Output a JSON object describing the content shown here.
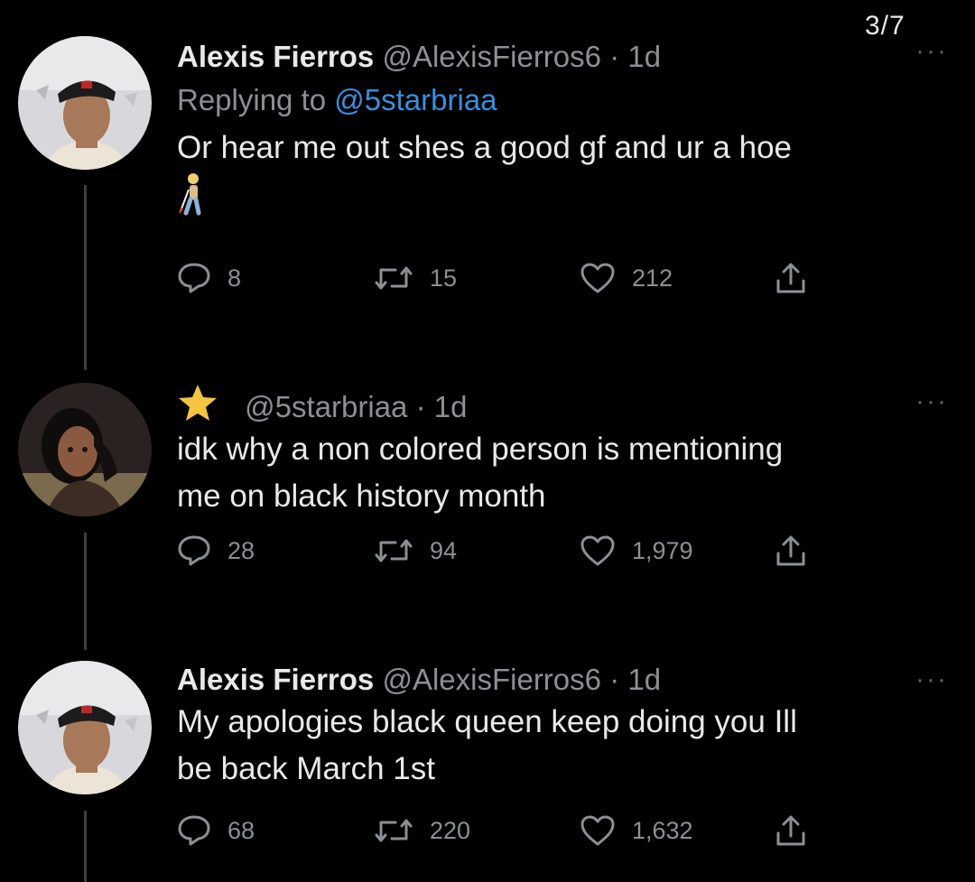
{
  "page_counter": "3/7",
  "more_label": "···",
  "tweets": [
    {
      "name": "Alexis Fierros",
      "handle": "@AlexisFierros6",
      "separator": "·",
      "time": "1d",
      "replying_prefix": "Replying to",
      "replying_to": "@5starbriaa",
      "text": "Or hear me out shes a good gf and ur a hoe",
      "emoji": "person-with-white-cane-emoji",
      "replies": "8",
      "retweets": "15",
      "likes": "212"
    },
    {
      "badge": "star-icon",
      "handle": "@5starbriaa",
      "separator": "·",
      "time": "1d",
      "text_line1": "idk why a non colored person is mentioning",
      "text_line2": "me on black history month",
      "replies": "28",
      "retweets": "94",
      "likes": "1,979"
    },
    {
      "name": "Alexis Fierros",
      "handle": "@AlexisFierros6",
      "separator": "·",
      "time": "1d",
      "text_line1": "My apologies black queen keep doing you Ill",
      "text_line2": "be back March 1st",
      "replies": "68",
      "retweets": "220",
      "likes": "1,632"
    }
  ],
  "colors": {
    "background": "#000000",
    "text": "#e7e9ea",
    "secondary": "#8b9096",
    "link": "#3a8fdc",
    "star": "#f4c542"
  }
}
